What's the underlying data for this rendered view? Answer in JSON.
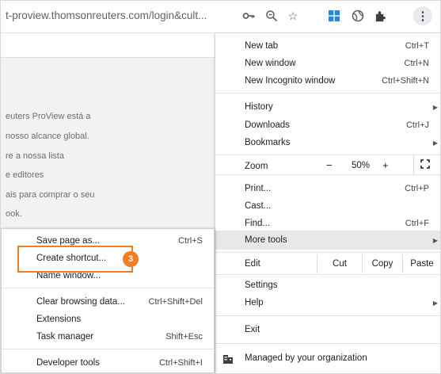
{
  "address_bar": {
    "url": "t-proview.thomsonreuters.com/login&cult..."
  },
  "toolbar_icons": [
    "key-icon",
    "zoom-icon",
    "star-icon",
    "windows-extension-icon",
    "globe-extension-icon",
    "puzzle-extensions-icon",
    "kebab-menu-icon"
  ],
  "background_page": {
    "lines": [
      "euters ProView está a",
      "nosso alcance global.",
      "re a nossa lista",
      "e editores",
      "ais para comprar o seu",
      "ook."
    ]
  },
  "menu": {
    "new_tab": {
      "label": "New tab",
      "shortcut": "Ctrl+T"
    },
    "new_window": {
      "label": "New window",
      "shortcut": "Ctrl+N"
    },
    "new_incognito": {
      "label": "New Incognito window",
      "shortcut": "Ctrl+Shift+N"
    },
    "history": {
      "label": "History"
    },
    "downloads": {
      "label": "Downloads",
      "shortcut": "Ctrl+J"
    },
    "bookmarks": {
      "label": "Bookmarks"
    },
    "zoom": {
      "label": "Zoom",
      "minus": "−",
      "value": "50%",
      "plus": "+",
      "fullscreen": "⛶"
    },
    "print": {
      "label": "Print...",
      "shortcut": "Ctrl+P"
    },
    "cast": {
      "label": "Cast..."
    },
    "find": {
      "label": "Find...",
      "shortcut": "Ctrl+F"
    },
    "more_tools": {
      "label": "More tools"
    },
    "edit": {
      "label": "Edit",
      "cut": "Cut",
      "copy": "Copy",
      "paste": "Paste"
    },
    "settings": {
      "label": "Settings"
    },
    "help": {
      "label": "Help"
    },
    "exit": {
      "label": "Exit"
    },
    "managed": {
      "label": "Managed by your organization"
    }
  },
  "submenu": {
    "save_page": {
      "label": "Save page as...",
      "shortcut": "Ctrl+S"
    },
    "create_shortcut": {
      "label": "Create shortcut..."
    },
    "name_window": {
      "label": "Name window..."
    },
    "clear_browsing": {
      "label": "Clear browsing data...",
      "shortcut": "Ctrl+Shift+Del"
    },
    "extensions": {
      "label": "Extensions"
    },
    "task_manager": {
      "label": "Task manager",
      "shortcut": "Shift+Esc"
    },
    "developer_tools": {
      "label": "Developer tools",
      "shortcut": "Ctrl+Shift+I"
    }
  },
  "callout": {
    "step": "3",
    "color": "#f07f22"
  }
}
